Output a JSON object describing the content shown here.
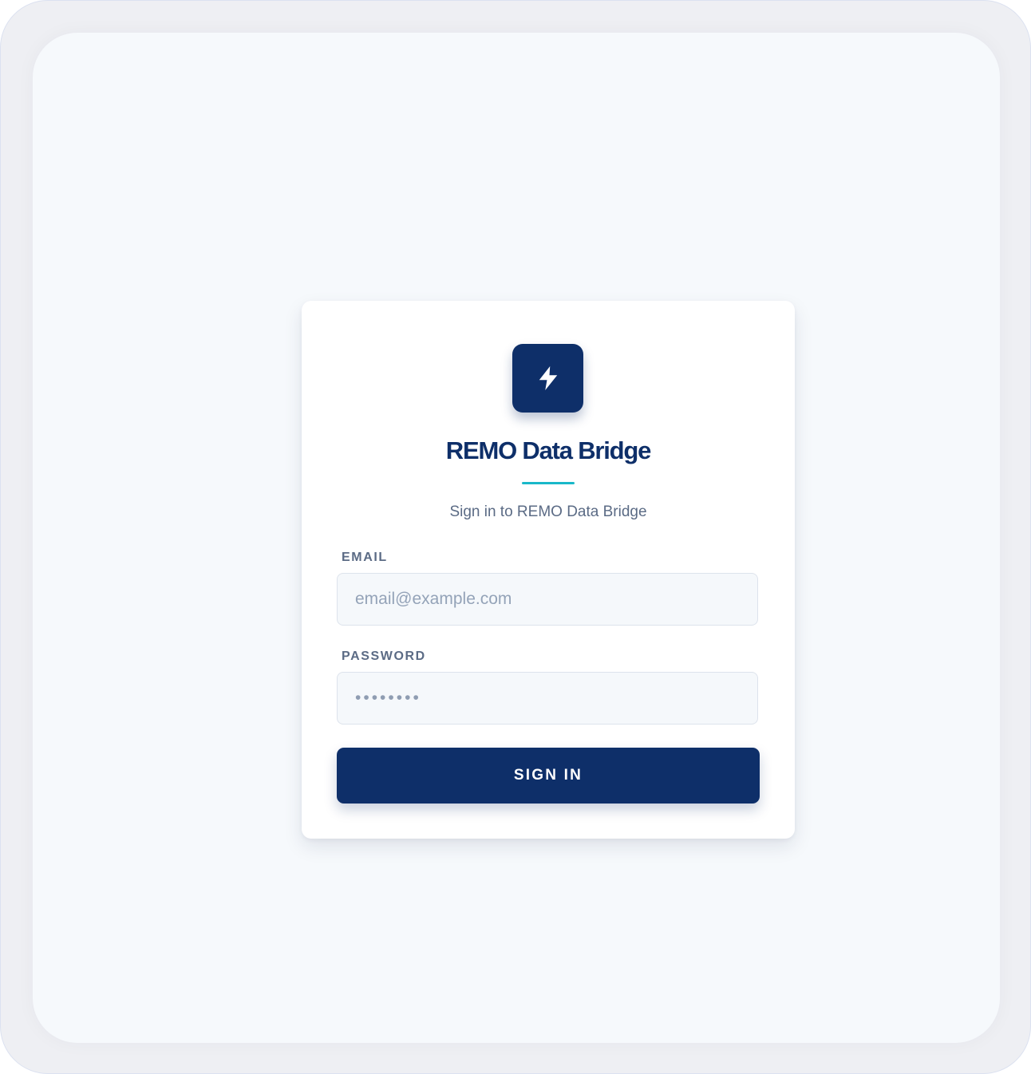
{
  "app": {
    "title": "REMO Data Bridge",
    "subtitle": "Sign in to REMO Data Bridge",
    "logo_icon": "lightning-bolt-icon"
  },
  "form": {
    "email_label": "EMAIL",
    "email_placeholder": "email@example.com",
    "password_label": "PASSWORD",
    "password_placeholder": "••••••••",
    "submit_label": "SIGN IN"
  },
  "colors": {
    "brand_navy": "#0e2f69",
    "accent_teal": "#19b8c9",
    "page_background": "#f6f9fc",
    "field_background": "#f5f8fb",
    "muted_text": "#5b6b85",
    "placeholder_text": "#94a3b8"
  }
}
